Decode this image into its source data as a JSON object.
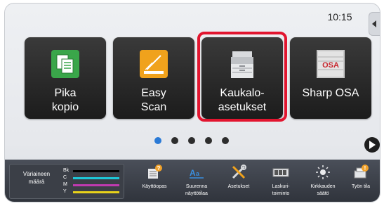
{
  "status_bar": {
    "time": "10:15"
  },
  "tiles": [
    {
      "label": "Pika\nkopio",
      "icon": "copy-icon",
      "color": "#3aa64a"
    },
    {
      "label": "Easy\nScan",
      "icon": "scan-icon",
      "color": "#f0a21c"
    },
    {
      "label": "Kaukalo-\nasetukset",
      "icon": "printer-icon",
      "color": "#cfd2d6"
    },
    {
      "label": "Sharp OSA",
      "icon": "osa-logo-icon",
      "color": "#c8c8c8"
    }
  ],
  "highlight_color": "#e2152f",
  "pagination": {
    "pages": 5,
    "current": 1
  },
  "toner": {
    "title": "Väriaineen\nmäärä",
    "rows": [
      {
        "letter": "Bk",
        "color": "#000000",
        "level": 1.0
      },
      {
        "letter": "C",
        "color": "#1ec8d8",
        "level": 1.0
      },
      {
        "letter": "M",
        "color": "#c03ab0",
        "level": 1.0
      },
      {
        "letter": "Y",
        "color": "#e8d21a",
        "level": 1.0
      }
    ]
  },
  "utilities": [
    {
      "label": "Käyttöopas",
      "icon": "manual-icon"
    },
    {
      "label": "Suurenna\nnäyttötilaa",
      "icon": "magnify-text-icon"
    },
    {
      "label": "Asetukset",
      "icon": "tools-icon"
    },
    {
      "label": "Laskuri-\ntoiminto",
      "icon": "counter-icon"
    },
    {
      "label": "Kirkkauden\nsäätö",
      "icon": "brightness-icon"
    },
    {
      "label": "Työn tila",
      "icon": "job-status-icon"
    }
  ]
}
